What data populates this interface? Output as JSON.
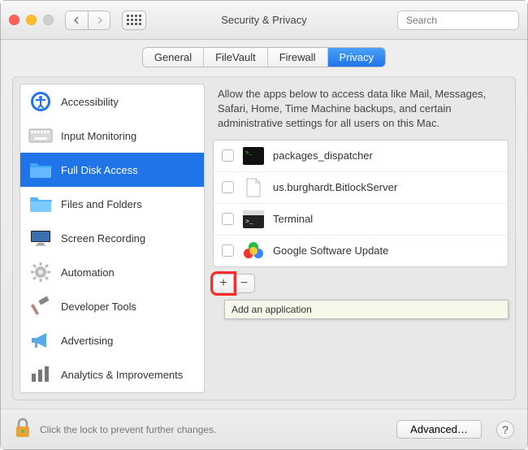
{
  "window": {
    "title": "Security & Privacy"
  },
  "search": {
    "placeholder": "Search"
  },
  "tabs": [
    {
      "label": "General",
      "active": false
    },
    {
      "label": "FileVault",
      "active": false
    },
    {
      "label": "Firewall",
      "active": false
    },
    {
      "label": "Privacy",
      "active": true
    }
  ],
  "sidebar": {
    "items": [
      {
        "label": "Accessibility",
        "icon": "accessibility-icon"
      },
      {
        "label": "Input Monitoring",
        "icon": "keyboard-icon"
      },
      {
        "label": "Full Disk Access",
        "icon": "folder-icon",
        "selected": true
      },
      {
        "label": "Files and Folders",
        "icon": "folder-icon"
      },
      {
        "label": "Screen Recording",
        "icon": "display-icon"
      },
      {
        "label": "Automation",
        "icon": "gear-icon"
      },
      {
        "label": "Developer Tools",
        "icon": "hammer-icon"
      },
      {
        "label": "Advertising",
        "icon": "megaphone-icon"
      },
      {
        "label": "Analytics & Improvements",
        "icon": "bars-icon"
      }
    ]
  },
  "main": {
    "description": "Allow the apps below to access data like Mail, Messages, Safari, Home, Time Machine backups, and certain administrative settings for all users on this Mac.",
    "apps": [
      {
        "name": "packages_dispatcher",
        "checked": false,
        "icon": "terminal-green-icon"
      },
      {
        "name": "us.burghardt.BitlockServer",
        "checked": false,
        "icon": "document-icon"
      },
      {
        "name": "Terminal",
        "checked": false,
        "icon": "terminal-icon"
      },
      {
        "name": "Google Software Update",
        "checked": false,
        "icon": "google-update-icon"
      }
    ],
    "add_label": "+",
    "remove_label": "−",
    "tooltip": "Add an application"
  },
  "footer": {
    "lock_text": "Click the lock to prevent further changes.",
    "advanced_label": "Advanced…",
    "help_label": "?"
  },
  "colors": {
    "accent": "#1f74e8",
    "highlight": "#ff2a2a"
  }
}
